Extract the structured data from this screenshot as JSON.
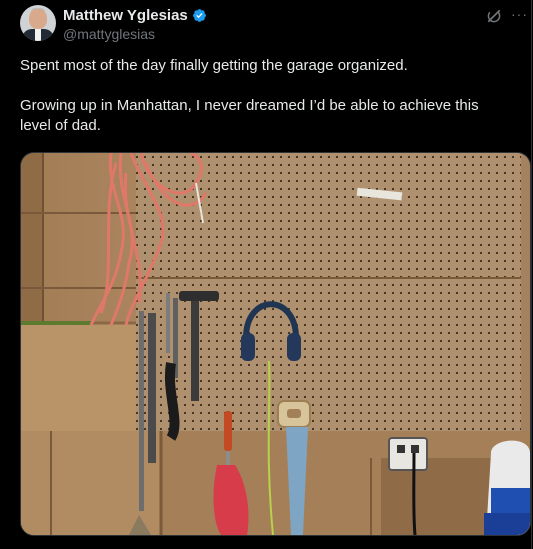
{
  "author": {
    "name": "Matthew Yglesias",
    "handle": "@mattyglesias",
    "verified": true,
    "avatar_icon": "avatar-photo"
  },
  "actions": {
    "grok_icon": "grok-icon",
    "more_icon": "more-options-icon",
    "more_label": "···"
  },
  "tweet": {
    "paragraphs": [
      "Spent most of the day finally getting the garage organized.",
      "Growing up in Manhattan, I never dreamed I’d be able to achieve this level of dad."
    ]
  },
  "media": {
    "description_icon": "garage-pegboard-photo"
  },
  "colors": {
    "background": "#000000",
    "text": "#e7e9ea",
    "secondary_text": "#71767b",
    "verified": "#1d9bf0",
    "border": "#2f3336"
  }
}
